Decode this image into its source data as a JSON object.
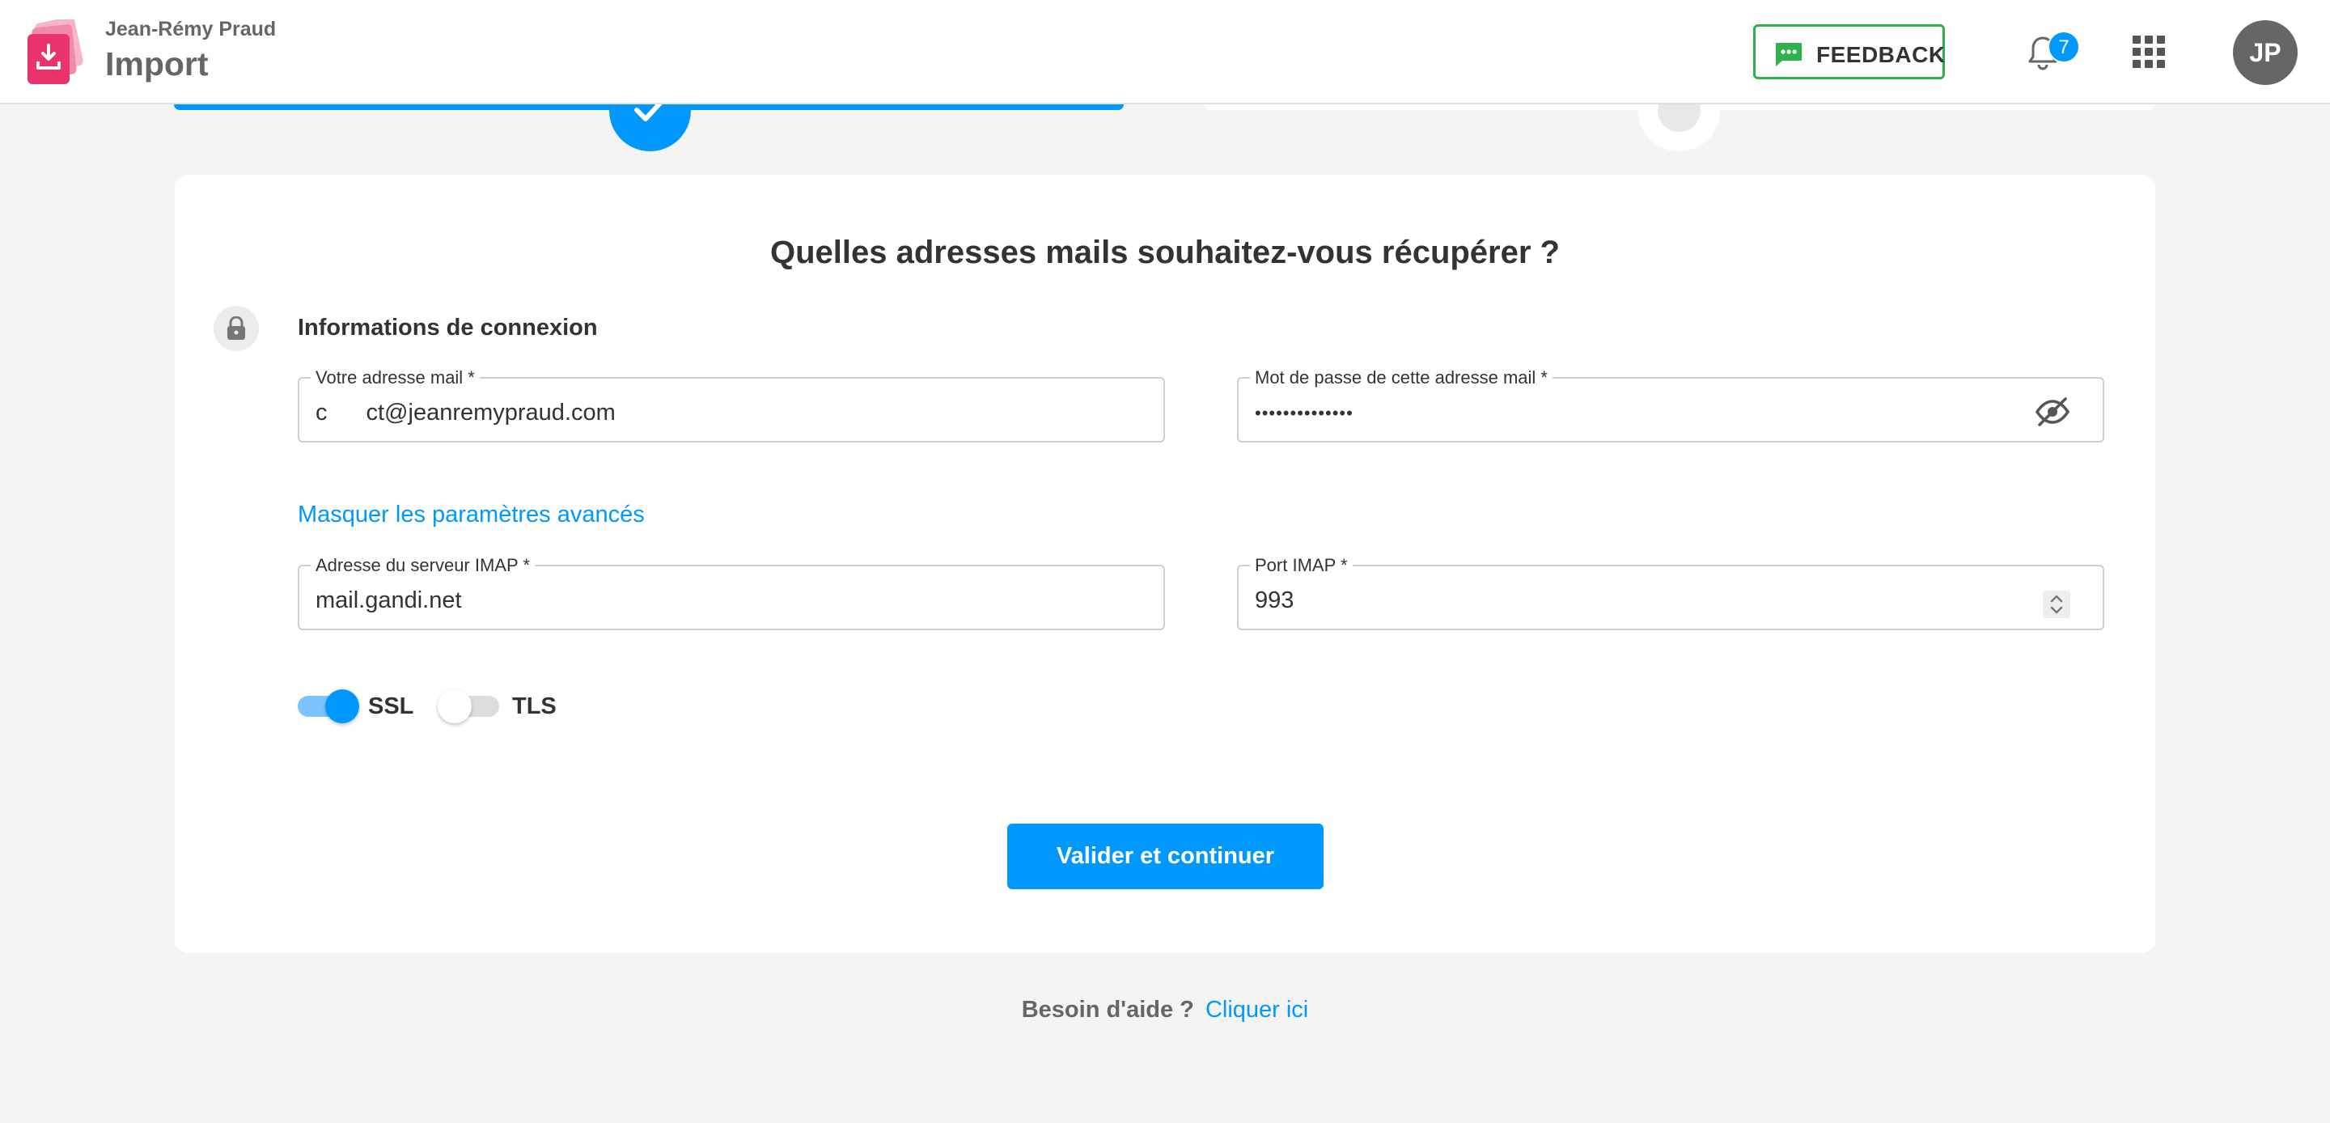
{
  "header": {
    "user_name": "Jean-Rémy Praud",
    "app_title": "Import",
    "feedback_label": "FEEDBACK",
    "notification_count": "7",
    "avatar_initials": "JP"
  },
  "stepper": {
    "steps": [
      {
        "status": "done"
      },
      {
        "status": "todo"
      }
    ]
  },
  "form": {
    "title": "Quelles adresses mails souhaitez-vous récupérer ?",
    "section_title": "Informations de connexion",
    "email": {
      "label": "Votre adresse mail *",
      "value_prefix": "c",
      "value_suffix": "ct@jeanremypraud.com"
    },
    "password": {
      "label": "Mot de passe de cette adresse mail *",
      "value_masked": "••••••••••••••"
    },
    "advanced_link": "Masquer les paramètres avancés",
    "imap_server": {
      "label": "Adresse du serveur IMAP *",
      "value": "mail.gandi.net"
    },
    "imap_port": {
      "label": "Port IMAP *",
      "value": "993"
    },
    "ssl": {
      "label": "SSL",
      "enabled": true
    },
    "tls": {
      "label": "TLS",
      "enabled": false
    },
    "submit_label": "Valider et continuer"
  },
  "help": {
    "text": "Besoin d'aide ?",
    "link": "Cliquer ici"
  },
  "colors": {
    "accent": "#0098ff",
    "feedback_green": "#2fb14c",
    "logo_pink": "#e8336b",
    "text_dark": "#333333",
    "text_grey": "#666666"
  },
  "icons": [
    "import-logo-icon",
    "chat-icon",
    "bell-icon",
    "apps-grid-icon",
    "check-icon",
    "lock-icon",
    "eye-off-icon",
    "spinner-arrows-icon"
  ]
}
